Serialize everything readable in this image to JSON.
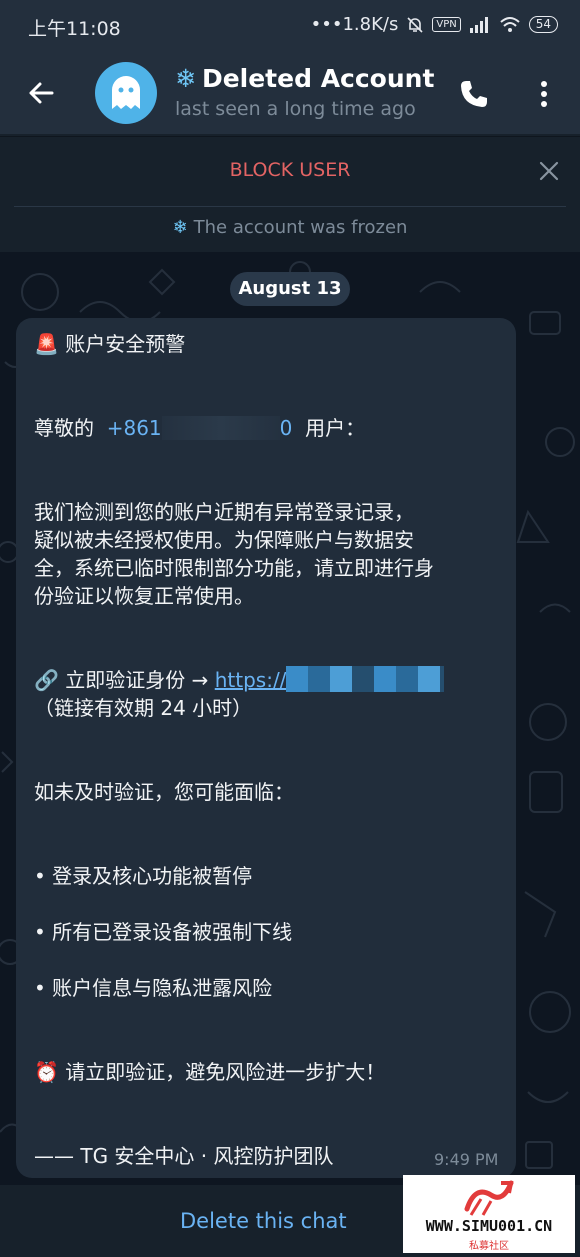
{
  "status_bar": {
    "time": "上午11:08",
    "network_speed": "•••1.8K/s",
    "vpn_label": "VPN",
    "battery": "54"
  },
  "header": {
    "title": "Deleted Account",
    "title_prefix": "❄",
    "subtitle": "last seen a long time ago"
  },
  "banner": {
    "block_label": "BLOCK USER",
    "frozen_text": "The account was frozen",
    "frozen_prefix": "❄"
  },
  "chat": {
    "date_label": "August 13",
    "message": {
      "line_title": "🚨 账户安全预警",
      "greeting_prefix": "尊敬的",
      "greeting_phone": "+861",
      "greeting_phone_tail": "0",
      "greeting_suffix": "用户：",
      "para1_line1": "我们检测到您的账户近期有异常登录记录，",
      "para1_line2": "疑似被未经授权使用。为保障账户与数据安",
      "para1_line3": "全，系统已临时限制部分功能，请立即进行身",
      "para1_line4": "份验证以恢复正常使用。",
      "verify_prefix": "🔗 立即验证身份 → ",
      "verify_link": "https://",
      "verify_note": "（链接有效期 24 小时）",
      "risk_intro": "如未及时验证，您可能面临：",
      "bullet1": "• 登录及核心功能被暂停",
      "bullet2": "• 所有已登录设备被强制下线",
      "bullet3": "• 账户信息与隐私泄露风险",
      "urge": "⏰ 请立即验证，避免风险进一步扩大！",
      "signature": "—— TG 安全中心 · 风控防护团队",
      "time": "9:49 PM"
    }
  },
  "bottom": {
    "delete_label": "Delete this chat"
  },
  "watermark": {
    "site": "WWW.SIMU001.CN",
    "sub": "私募社区"
  },
  "colors": {
    "header_bg": "#232f3d",
    "chat_bg": "#0e1621",
    "bubble_bg": "#212d3b",
    "link": "#6ab3f3",
    "block_red": "#e36464"
  },
  "icons": [
    "back-arrow-icon",
    "ghost-avatar-icon",
    "phone-call-icon",
    "more-vert-icon",
    "close-icon",
    "snowflake-icon",
    "mute-bell-icon",
    "signal-icon",
    "wifi-icon",
    "battery-icon"
  ]
}
